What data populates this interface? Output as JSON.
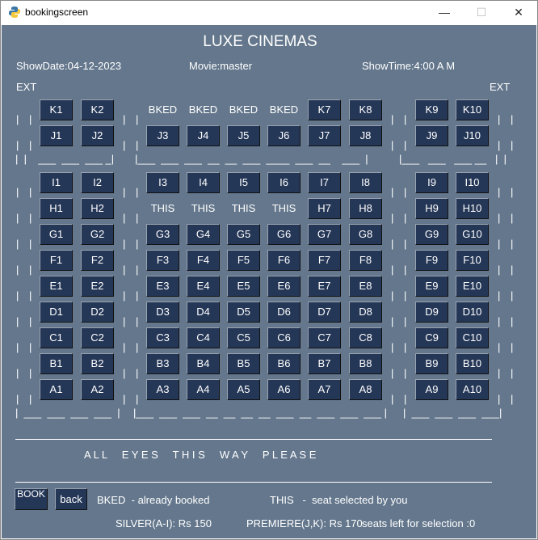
{
  "window": {
    "title": "bookingscreen",
    "minimize": "—",
    "maximize": "☐",
    "close": "✕"
  },
  "header": {
    "title": "LUXE CINEMAS",
    "show_date": "ShowDate:04-12-2023",
    "movie": "Movie:master",
    "show_time": "ShowTime:4:00 A M"
  },
  "exits": {
    "left": "EXT",
    "right": "EXT"
  },
  "rows": [
    {
      "row": "K",
      "seats": [
        "K1",
        "K2",
        "BKED",
        "BKED",
        "BKED",
        "BKED",
        "K7",
        "K8",
        "K9",
        "K10"
      ]
    },
    {
      "row": "J",
      "seats": [
        "J1",
        "J2",
        "J3",
        "J4",
        "J5",
        "J6",
        "J7",
        "J8",
        "J9",
        "J10"
      ]
    },
    {
      "row": "I",
      "seats": [
        "I1",
        "I2",
        "I3",
        "I4",
        "I5",
        "I6",
        "I7",
        "I8",
        "I9",
        "I10"
      ]
    },
    {
      "row": "H",
      "seats": [
        "H1",
        "H2",
        "THIS",
        "THIS",
        "THIS",
        "THIS",
        "H7",
        "H8",
        "H9",
        "H10"
      ]
    },
    {
      "row": "G",
      "seats": [
        "G1",
        "G2",
        "G3",
        "G4",
        "G5",
        "G6",
        "G7",
        "G8",
        "G9",
        "G10"
      ]
    },
    {
      "row": "F",
      "seats": [
        "F1",
        "F2",
        "F3",
        "F4",
        "F5",
        "F6",
        "F7",
        "F8",
        "F9",
        "F10"
      ]
    },
    {
      "row": "E",
      "seats": [
        "E1",
        "E2",
        "E3",
        "E4",
        "E5",
        "E6",
        "E7",
        "E8",
        "E9",
        "E10"
      ]
    },
    {
      "row": "D",
      "seats": [
        "D1",
        "D2",
        "D3",
        "D4",
        "D5",
        "D6",
        "D7",
        "D8",
        "D9",
        "D10"
      ]
    },
    {
      "row": "C",
      "seats": [
        "C1",
        "C2",
        "C3",
        "C4",
        "C5",
        "C6",
        "C7",
        "C8",
        "C9",
        "C10"
      ]
    },
    {
      "row": "B",
      "seats": [
        "B1",
        "B2",
        "B3",
        "B4",
        "B5",
        "B6",
        "B7",
        "B8",
        "B9",
        "B10"
      ]
    },
    {
      "row": "A",
      "seats": [
        "A1",
        "A2",
        "A3",
        "A4",
        "A5",
        "A6",
        "A7",
        "A8",
        "A9",
        "A10"
      ]
    }
  ],
  "aisle_row": {
    "left": "|  |    ___  ___  ___ _|",
    "mid": "|___  ___  ___  __  __  ___  ____  ___  __    ___  |",
    "right": "|___   ___   ___ __   |  |"
  },
  "bottom_row": {
    "left": "|  ___  ___  ___  ___  |",
    "mid": "|___  ___  ___  __  __  __  __  ___  __  ___  ___  ___ |",
    "right": "|  ___  ___  ___  ___|"
  },
  "screen_text": "A L L     E Y E S     T H I S     W A Y     P L E A S E",
  "footer": {
    "book": "BOOK",
    "back": "back",
    "bked_legend": "BKED  - already booked",
    "this_legend": "THIS   -  seat selected by you",
    "silver": "SILVER(A-I): Rs 150",
    "premiere": "PREMIERE(J,K): Rs 170",
    "seats_left": "seats left for selection :0"
  }
}
